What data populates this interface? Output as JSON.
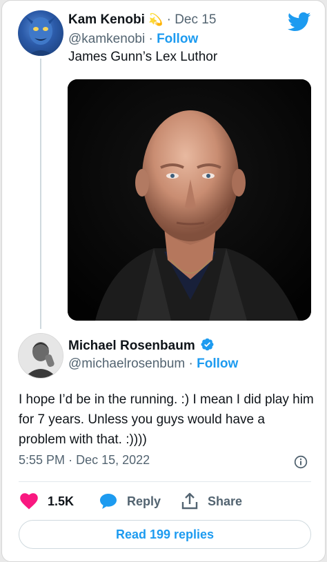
{
  "tweet_1": {
    "author_name": "Kam Kenobi",
    "badge_emoji": "💫",
    "date": "Dec 15",
    "handle": "@kamkenobi",
    "follow_label": "Follow",
    "text": "James Gunn’s Lex Luthor"
  },
  "tweet_2": {
    "author_name": "Michael Rosenbaum",
    "handle": "@michaelrosenbum",
    "follow_label": "Follow",
    "text": "I hope I’d be in the running. :) I mean I did play him for 7 years. Unless you guys would have a problem with that.  :))))",
    "time": "5:55 PM",
    "date": "Dec 15, 2022"
  },
  "actions": {
    "likes_count": "1.5K",
    "reply_label": "Reply",
    "share_label": "Share"
  },
  "read_replies_label": "Read 199 replies",
  "separator": "·",
  "colors": {
    "accent_blue": "#1d9bf0",
    "like_pink": "#f91880",
    "verified_blue": "#1d9bf0",
    "muted_text": "#536471"
  },
  "icons": {
    "brand": "twitter-bird-icon",
    "verified": "verified-badge-icon",
    "info": "info-icon",
    "like": "heart-icon",
    "reply": "speech-bubble-icon",
    "share": "share-upload-icon"
  }
}
